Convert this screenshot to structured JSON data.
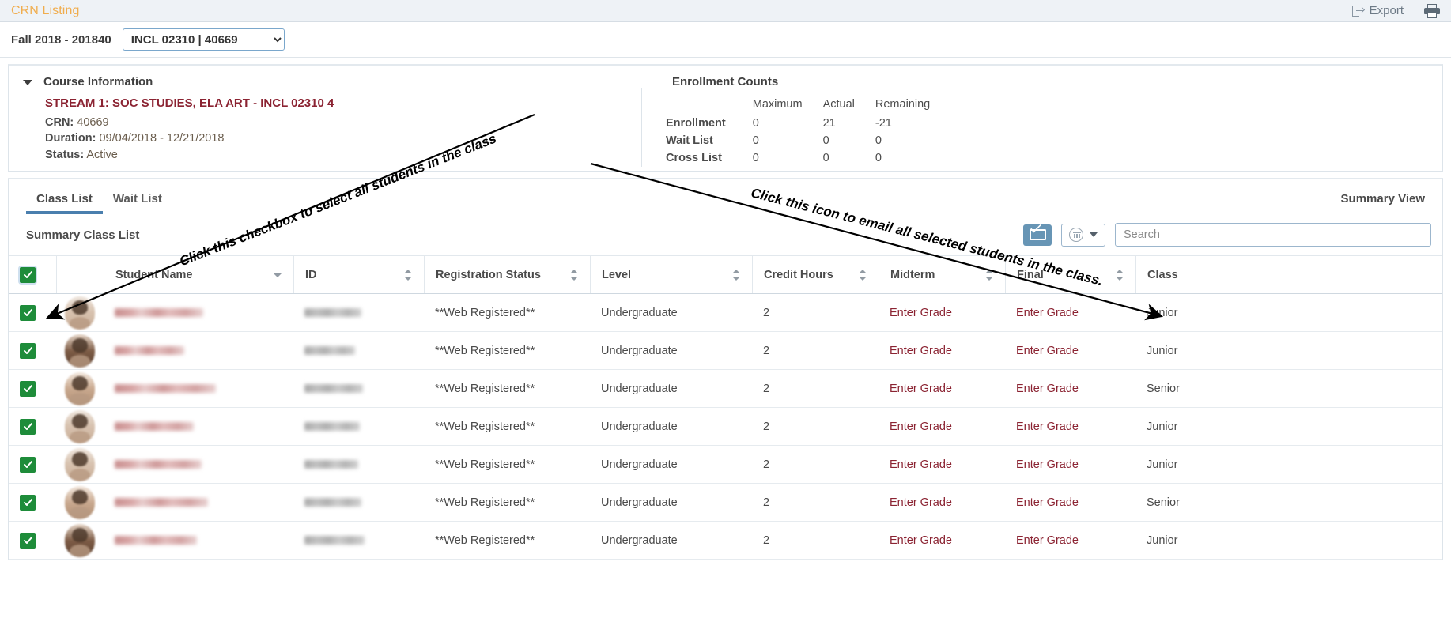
{
  "header": {
    "title": "CRN Listing",
    "export_label": "Export",
    "export_icon": "export-icon",
    "print_icon": "printer-icon"
  },
  "term_bar": {
    "term_label": "Fall 2018 - 201840",
    "crn_selected": "INCL 02310 | 40669",
    "crn_options": [
      "INCL 02310 | 40669"
    ]
  },
  "course_information": {
    "section_title": "Course Information",
    "collapse_icon": "chevron-down-icon",
    "course_title": "STREAM 1: SOC STUDIES, ELA ART - INCL 02310 4",
    "crn_label": "CRN:",
    "crn_value": "40669",
    "duration_label": "Duration:",
    "duration_value": "09/04/2018 - 12/21/2018",
    "status_label": "Status:",
    "status_value": "Active"
  },
  "enrollment_counts": {
    "title": "Enrollment Counts",
    "columns": [
      "Maximum",
      "Actual",
      "Remaining"
    ],
    "rows": [
      {
        "label": "Enrollment",
        "maximum": "0",
        "actual": "21",
        "remaining": "-21"
      },
      {
        "label": "Wait List",
        "maximum": "0",
        "actual": "0",
        "remaining": "0"
      },
      {
        "label": "Cross List",
        "maximum": "0",
        "actual": "0",
        "remaining": "0"
      }
    ]
  },
  "tabs": {
    "items": [
      {
        "label": "Class List",
        "active": true
      },
      {
        "label": "Wait List",
        "active": false
      }
    ],
    "summary_view": "Summary View"
  },
  "toolbar": {
    "summary_class_list": "Summary Class List",
    "mail_icon": "envelope-icon",
    "columns_icon": "columns-icon",
    "columns_caret_icon": "caret-down-icon",
    "search_placeholder": "Search",
    "search_value": ""
  },
  "table": {
    "select_all_checked": true,
    "columns": [
      {
        "key": "check",
        "label": "",
        "sort": "none"
      },
      {
        "key": "avatar",
        "label": "",
        "sort": "none"
      },
      {
        "key": "student_name",
        "label": "Student Name",
        "sort": "desc"
      },
      {
        "key": "id",
        "label": "ID",
        "sort": "both"
      },
      {
        "key": "registration_status",
        "label": "Registration Status",
        "sort": "both"
      },
      {
        "key": "level",
        "label": "Level",
        "sort": "both"
      },
      {
        "key": "credit_hours",
        "label": "Credit Hours",
        "sort": "both"
      },
      {
        "key": "midterm",
        "label": "Midterm",
        "sort": "both"
      },
      {
        "key": "final",
        "label": "Final",
        "sort": "both"
      },
      {
        "key": "class",
        "label": "Class",
        "sort": "none"
      }
    ],
    "rows": [
      {
        "checked": true,
        "student_name": "",
        "id": "",
        "registration_status": "**Web Registered**",
        "level": "Undergraduate",
        "credit_hours": "2",
        "midterm": "Enter Grade",
        "final": "Enter Grade",
        "class": "Junior"
      },
      {
        "checked": true,
        "student_name": "",
        "id": "",
        "registration_status": "**Web Registered**",
        "level": "Undergraduate",
        "credit_hours": "2",
        "midterm": "Enter Grade",
        "final": "Enter Grade",
        "class": "Junior"
      },
      {
        "checked": true,
        "student_name": "",
        "id": "",
        "registration_status": "**Web Registered**",
        "level": "Undergraduate",
        "credit_hours": "2",
        "midterm": "Enter Grade",
        "final": "Enter Grade",
        "class": "Senior"
      },
      {
        "checked": true,
        "student_name": "",
        "id": "",
        "registration_status": "**Web Registered**",
        "level": "Undergraduate",
        "credit_hours": "2",
        "midterm": "Enter Grade",
        "final": "Enter Grade",
        "class": "Junior"
      },
      {
        "checked": true,
        "student_name": "",
        "id": "",
        "registration_status": "**Web Registered**",
        "level": "Undergraduate",
        "credit_hours": "2",
        "midterm": "Enter Grade",
        "final": "Enter Grade",
        "class": "Junior"
      },
      {
        "checked": true,
        "student_name": "",
        "id": "",
        "registration_status": "**Web Registered**",
        "level": "Undergraduate",
        "credit_hours": "2",
        "midterm": "Enter Grade",
        "final": "Enter Grade",
        "class": "Senior"
      },
      {
        "checked": true,
        "student_name": "",
        "id": "",
        "registration_status": "**Web Registered**",
        "level": "Undergraduate",
        "credit_hours": "2",
        "midterm": "Enter Grade",
        "final": "Enter Grade",
        "class": "Junior"
      }
    ]
  },
  "annotations": [
    {
      "text": "Click this checkbox to select all students in the class"
    },
    {
      "text": "Click this icon to email all selected students in the class."
    }
  ],
  "colors": {
    "header_title": "#f0ad4e",
    "course_title": "#8b2332",
    "link": "#8b2332",
    "checkbox": "#1e8c3a",
    "mail_button": "#6795b5",
    "tab_underline": "#4a7fae"
  }
}
